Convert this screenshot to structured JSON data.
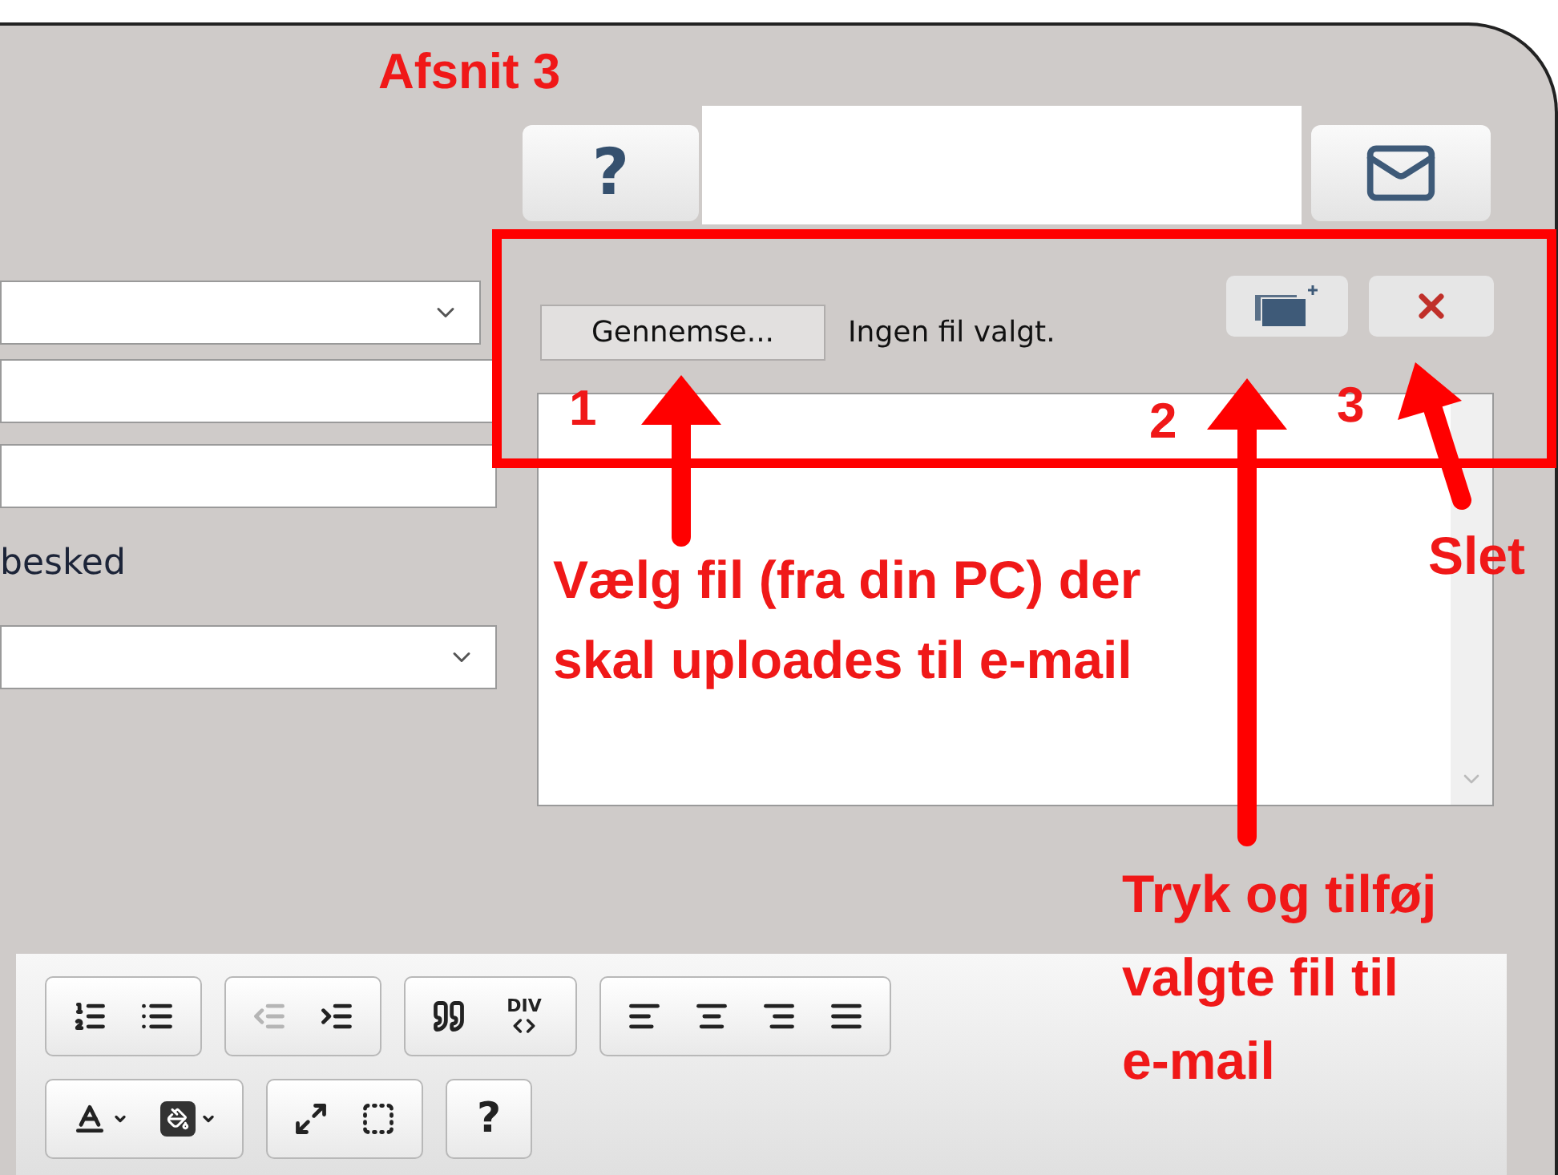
{
  "form": {
    "label": "besked"
  },
  "top_bar": {
    "help_button": "?"
  },
  "attachments": {
    "browse_button": "Gennemse...",
    "file_status": "Ingen fil valgt."
  },
  "toolbar": {
    "rows": [
      {
        "groups": [
          {
            "items": [
              {
                "kind": "icon",
                "disabled": false
              },
              {
                "kind": "icon",
                "disabled": false
              }
            ]
          },
          {
            "items": [
              {
                "kind": "icon",
                "disabled": true
              },
              {
                "kind": "icon",
                "disabled": false
              }
            ]
          },
          {
            "items": [
              {
                "kind": "icon",
                "disabled": false
              },
              {
                "kind": "code",
                "label": "DIV",
                "disabled": false
              }
            ]
          },
          {
            "items": [
              {
                "kind": "icon",
                "disabled": false
              },
              {
                "kind": "icon",
                "disabled": false
              },
              {
                "kind": "icon",
                "disabled": false
              },
              {
                "kind": "icon",
                "disabled": false
              }
            ]
          }
        ]
      },
      {
        "groups": [
          {
            "items": [
              {
                "kind": "icon",
                "disabled": false
              },
              {
                "kind": "icon",
                "disabled": false
              }
            ]
          },
          {
            "items": [
              {
                "kind": "icon",
                "disabled": false
              },
              {
                "kind": "icon",
                "disabled": false
              }
            ]
          },
          {
            "items": [
              {
                "kind": "text",
                "label": "?",
                "disabled": false
              }
            ]
          }
        ]
      }
    ]
  },
  "annotations": {
    "title": "Afsnit 3",
    "markers": [
      "1",
      "2",
      "3"
    ],
    "notes": [
      "Vælg fil (fra din PC) der skal uploades til e-mail",
      "Slet",
      "Tryk og tilføj valgte fil til e-mail"
    ]
  }
}
